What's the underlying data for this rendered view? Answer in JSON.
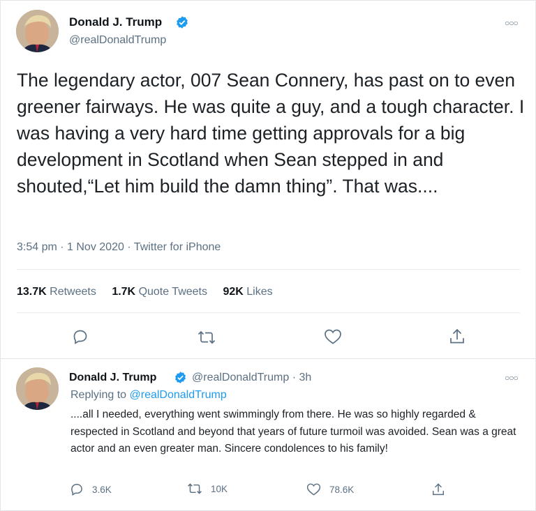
{
  "main_tweet": {
    "author_name": "Donald J. Trump",
    "author_handle": "@realDonaldTrump",
    "text": "The legendary actor, 007 Sean Connery, has past on to even greener fairways. He was quite a guy, and a tough character. I was having a very hard time getting approvals for a big development in Scotland when Sean stepped in and shouted,“Let him build the damn thing”. That was....",
    "meta": "3:54 pm · 1 Nov 2020 · Twitter for iPhone",
    "stats": {
      "retweets_count": "13.7K",
      "retweets_label": "Retweets",
      "quotes_count": "1.7K",
      "quotes_label": "Quote Tweets",
      "likes_count": "92K",
      "likes_label": "Likes"
    },
    "actions": [
      "reply-icon",
      "retweet-icon",
      "like-icon",
      "share-icon"
    ]
  },
  "reply_tweet": {
    "author_name": "Donald J. Trump",
    "author_handle_time": "@realDonaldTrump · 3h",
    "replying_to_label": "Replying to",
    "replying_to_handle": "@realDonaldTrump",
    "text": "....all I needed, everything went swimmingly from there. He was so highly regarded & respected in Scotland and beyond that years of future turmoil was avoided. Sean was a great actor and an even greater man. Sincere condolences to his family!",
    "counts": {
      "replies": "3.6K",
      "retweets": "10K",
      "likes": "78.6K"
    }
  },
  "colors": {
    "verified": "#1d9bf0",
    "secondary_text": "#5b7083",
    "link": "#1d9bf0"
  }
}
